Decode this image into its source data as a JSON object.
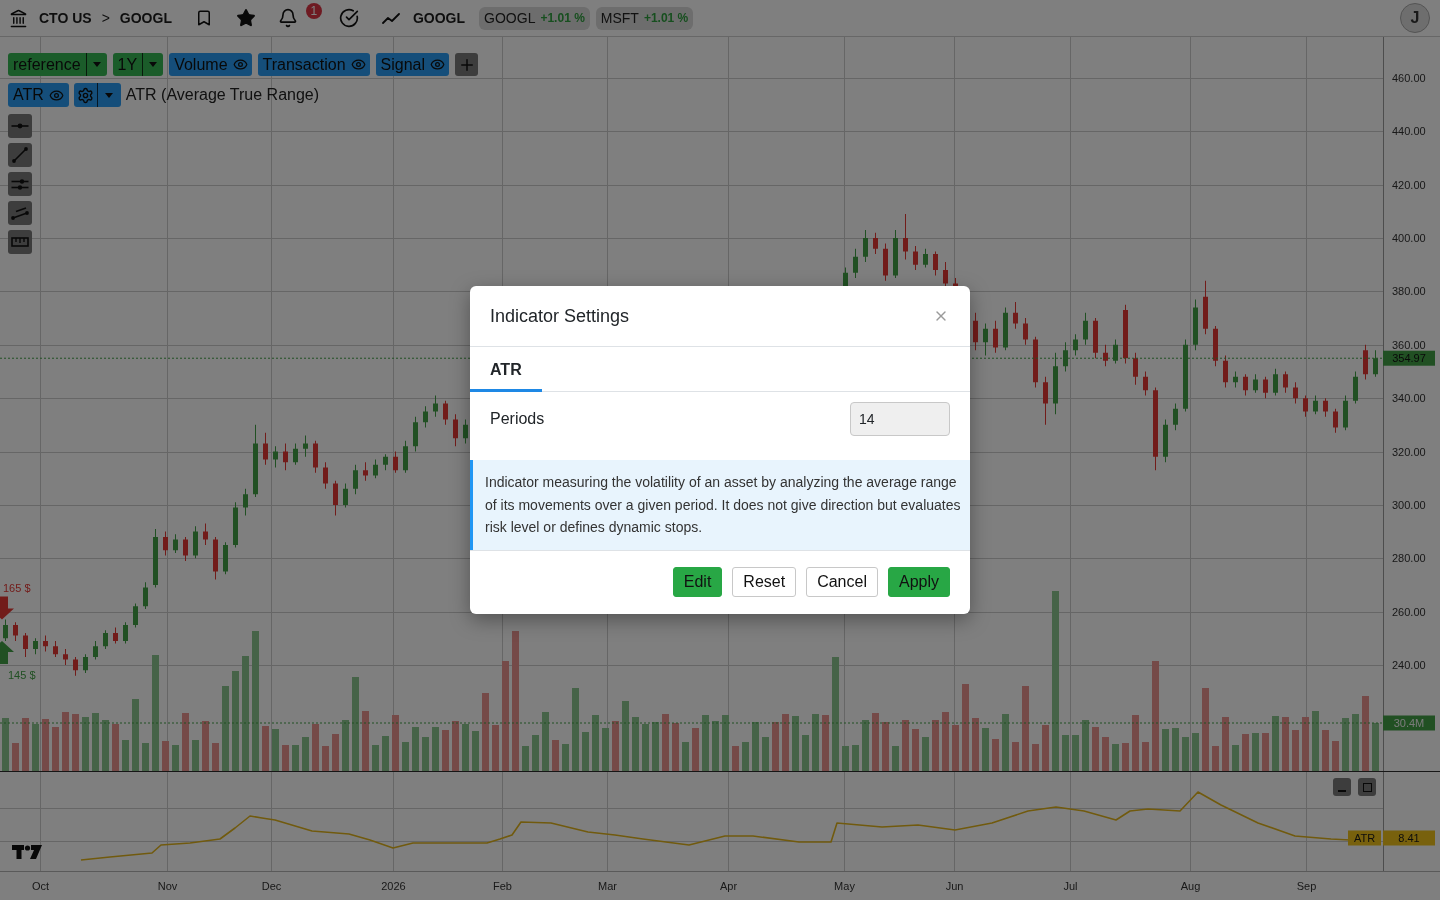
{
  "top_bar": {
    "breadcrumb": {
      "parent": "CTO US",
      "separator": ">",
      "current": "GOOGL"
    },
    "notifications": {
      "count": "1"
    },
    "symbol": "GOOGL",
    "watchlist": [
      {
        "symbol": "GOOGL",
        "change": "+1.01 %"
      },
      {
        "symbol": "MSFT",
        "change": "+1.01 %"
      }
    ],
    "avatar": {
      "initial": "J"
    }
  },
  "toolbar": {
    "dropdowns": [
      {
        "label": "reference"
      },
      {
        "label": "1Y"
      }
    ],
    "layers": [
      {
        "label": "Volume",
        "visible": true
      },
      {
        "label": "Transaction",
        "visible": true
      },
      {
        "label": "Signal",
        "visible": true
      }
    ],
    "indicators": [
      {
        "label": "ATR",
        "visible": true
      }
    ],
    "indicator_title": "ATR (Average True Range)"
  },
  "chart": {
    "price_axis": [
      "460.00",
      "440.00",
      "420.00",
      "400.00",
      "380.00",
      "360.00",
      "340.00",
      "320.00",
      "300.00",
      "280.00",
      "260.00",
      "240.00"
    ],
    "time_axis": [
      "Oct",
      "Nov",
      "Dec",
      "2026",
      "Feb",
      "Mar",
      "Apr",
      "May",
      "Jun",
      "Jul",
      "Aug",
      "Sep"
    ],
    "trade_markers": [
      {
        "kind": "sell",
        "label": "165 $"
      },
      {
        "kind": "buy",
        "label": "145 $"
      }
    ],
    "last_price": "354.97",
    "volume": "30.4M"
  },
  "atr_pane": {
    "label": "ATR",
    "value": "8.41"
  },
  "modal": {
    "title": "Indicator Settings",
    "tabs": [
      {
        "label": "ATR",
        "selected": true
      }
    ],
    "fields": [
      {
        "label": "Periods",
        "value": "14"
      }
    ],
    "description": "Indicator measuring the volatility of an asset by analyzing the average range of its movements over a given period. It does not give direction but evaluates risk level or defines dynamic stops.",
    "buttons": [
      {
        "label": "Edit",
        "kind": "filled"
      },
      {
        "label": "Reset",
        "kind": "outline"
      },
      {
        "label": "Cancel",
        "kind": "outline"
      },
      {
        "label": "Apply",
        "kind": "filled"
      }
    ]
  }
}
